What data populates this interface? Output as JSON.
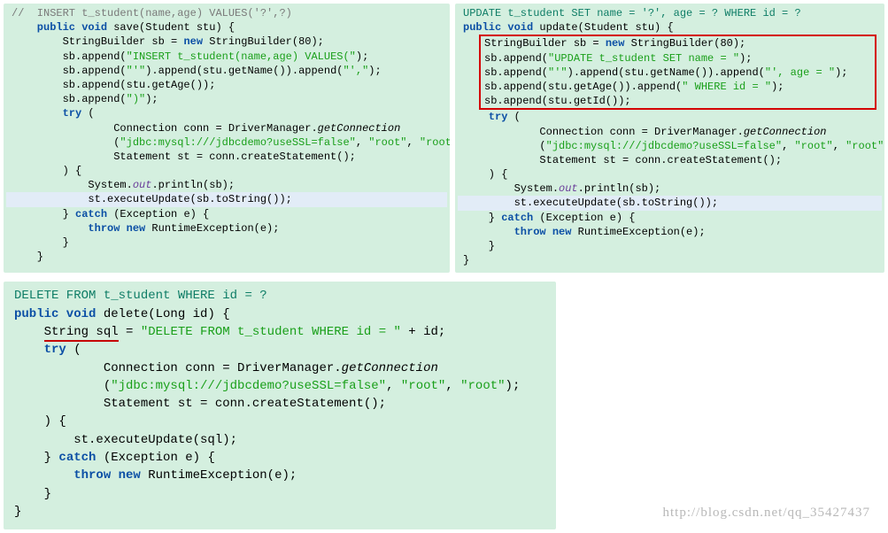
{
  "panel_save": {
    "comment": "//  INSERT t_student(name,age) VALUES('?',?)",
    "sig": "    public void save(Student stu) {",
    "l1a": "        StringBuilder sb = ",
    "l1b": "new",
    "l1c": " StringBuilder(80);",
    "l2a": "        sb.append(",
    "l2s": "\"INSERT t_student(name,age) VALUES(\"",
    "l2b": ");",
    "l3a": "        sb.append(",
    "l3s1": "\"'\"",
    "l3b": ").append(stu.getName()).append(",
    "l3s2": "\"',\"",
    "l3c": ");",
    "l4": "        sb.append(stu.getAge());",
    "l5a": "        sb.append(",
    "l5s": "\")\"",
    "l5b": ");",
    "ltry": "        try (",
    "lconn": "                Connection conn = DriverManager.",
    "lconn_i": "getConnection",
    "largs_a": "                (",
    "largs_s1": "\"jdbc:mysql:///jdbcdemo?useSSL=false\"",
    "largs_b": ", ",
    "largs_s2": "\"root\"",
    "largs_c": ", ",
    "largs_s3": "\"root\"",
    "largs_d": ");",
    "lst": "                Statement st = conn.createStatement();",
    "lclose": "        ) {",
    "lprint_a": "            System.",
    "lprint_out": "out",
    "lprint_b": ".println(sb);",
    "lexec": "            st.executeUpdate(sb.toString());",
    "lcatch_a": "        } ",
    "lcatch_kw": "catch",
    "lcatch_b": " (Exception e) {",
    "lthrow_a": "            ",
    "lthrow_kw": "throw new",
    "lthrow_b": " RuntimeException(e);",
    "lend1": "        }",
    "lend2": "    }"
  },
  "panel_update": {
    "top": "UPDATE t_student SET name = '?', age = ? WHERE id = ?  ",
    "sig": "public void update(Student stu) {",
    "r1a": "StringBuilder sb = ",
    "r1b": "new",
    "r1c": " StringBuilder(80);",
    "r2a": "sb.append(",
    "r2s": "\"UPDATE t_student SET name = \"",
    "r2b": ");",
    "r3a": "sb.append(",
    "r3s1": "\"'\"",
    "r3b": ").append(stu.getName()).append(",
    "r3s2": "\"', age = \"",
    "r3c": ");",
    "r4a": "sb.append(stu.getAge()).append(",
    "r4s": "\" WHERE id = \"",
    "r4b": ");",
    "r5": "sb.append(stu.getId());",
    "ltry": "    try (",
    "lconn": "            Connection conn = DriverManager.",
    "lconn_i": "getConnection",
    "largs_a": "            (",
    "largs_s1": "\"jdbc:mysql:///jdbcdemo?useSSL=false\"",
    "largs_b": ", ",
    "largs_s2": "\"root\"",
    "largs_c": ", ",
    "largs_s3": "\"root\"",
    "largs_d": ");",
    "lst": "            Statement st = conn.createStatement();",
    "lclose": "    ) {",
    "lprint_a": "        System.",
    "lprint_out": "out",
    "lprint_b": ".println(sb);",
    "lexec": "        st.executeUpdate(sb.toString());",
    "lcatch_a": "    } ",
    "lcatch_kw": "catch",
    "lcatch_b": " (Exception e) {",
    "lthrow_a": "        ",
    "lthrow_kw": "throw new",
    "lthrow_b": " RuntimeException(e);",
    "lend1": "    }",
    "lend2": "}"
  },
  "panel_delete": {
    "top": "DELETE FROM t_student WHERE id = ?",
    "sig_a": "public void",
    "sig_b": " delete(Long id) {",
    "l1_pad": "    ",
    "l1_a": "String sql",
    "l1_b": " = ",
    "l1_s": "\"DELETE FROM t_student WHERE id = \"",
    "l1_c": " + id;",
    "ltry": "    try (",
    "lconn": "            Connection conn = DriverManager.",
    "lconn_i": "getConnection",
    "largs_a": "            (",
    "largs_s1": "\"jdbc:mysql:///jdbcdemo?useSSL=false\"",
    "largs_b": ", ",
    "largs_s2": "\"root\"",
    "largs_c": ", ",
    "largs_s3": "\"root\"",
    "largs_d": ");",
    "lst": "            Statement st = conn.createStatement();",
    "lclose": "    ) {",
    "lexec": "        st.executeUpdate(sql);",
    "lcatch_a": "    } ",
    "lcatch_kw": "catch",
    "lcatch_b": " (Exception e) {",
    "lthrow_a": "        ",
    "lthrow_kw": "throw new",
    "lthrow_b": " RuntimeException(e);",
    "lend1": "    }",
    "lend2": "}"
  },
  "watermark": "http://blog.csdn.net/qq_35427437"
}
